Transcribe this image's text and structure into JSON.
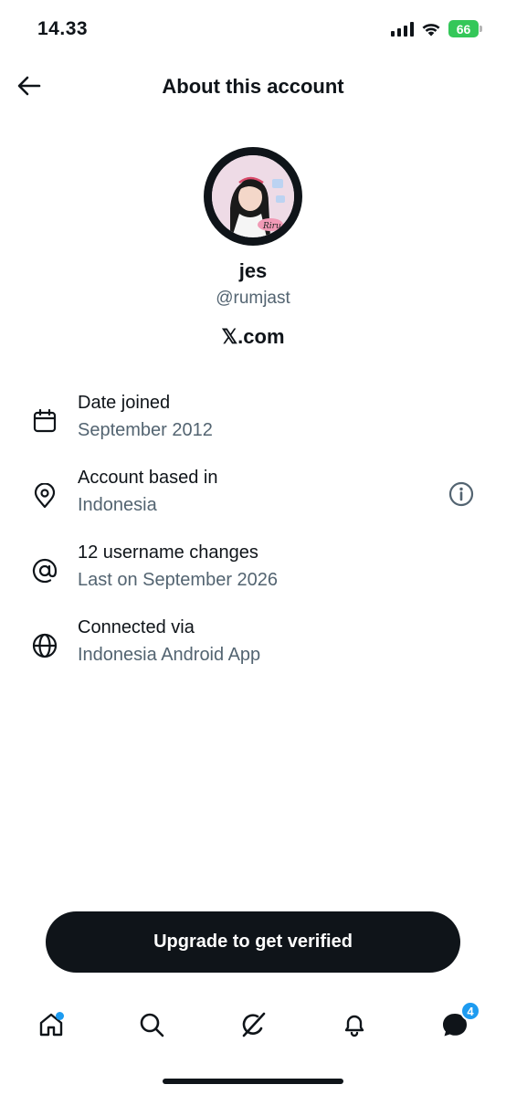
{
  "status_bar": {
    "time": "14.33",
    "battery": "66"
  },
  "header": {
    "title": "About this account"
  },
  "profile": {
    "name": "jes",
    "handle": "@rumjast",
    "domain": "𝕏.com",
    "avatar_text": "Riru"
  },
  "info": [
    {
      "icon": "calendar-icon",
      "title": "Date joined",
      "subtitle": "September 2012"
    },
    {
      "icon": "location-pin-icon",
      "title": "Account based in",
      "subtitle": "Indonesia",
      "extra_icon": "info-icon"
    },
    {
      "icon": "at-sign-icon",
      "title": "12 username changes",
      "subtitle": "Last on September 2026"
    },
    {
      "icon": "globe-icon",
      "title": "Connected via",
      "subtitle": "Indonesia Android App"
    }
  ],
  "upgrade_button": {
    "label": "Upgrade to get verified"
  },
  "bottom_nav": {
    "items": [
      {
        "icon": "home-icon",
        "has_dot": true
      },
      {
        "icon": "search-icon"
      },
      {
        "icon": "grok-icon"
      },
      {
        "icon": "bell-icon"
      },
      {
        "icon": "messages-icon",
        "badge": "4"
      }
    ]
  },
  "colors": {
    "primary_text": "#0f1419",
    "secondary_text": "#536471",
    "accent": "#1d9bf0",
    "battery": "#34c759"
  }
}
